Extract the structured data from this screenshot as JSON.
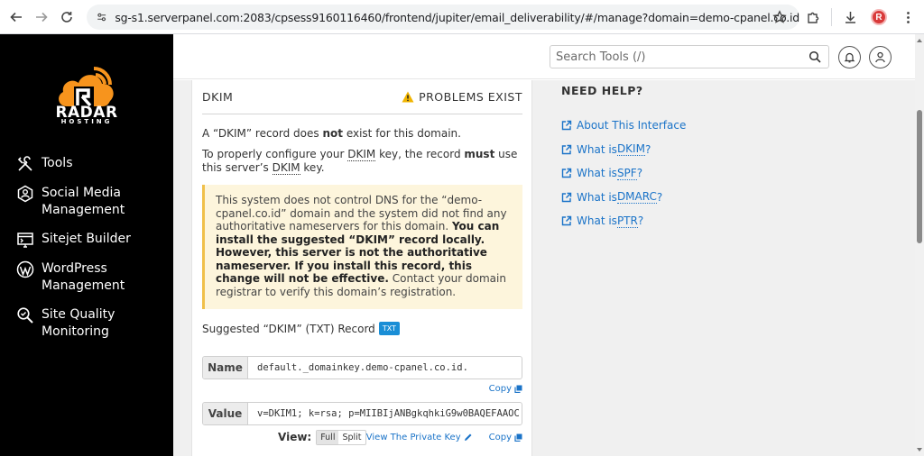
{
  "browser": {
    "url": "sg-s1.serverpanel.com:2083/cpsess9160116460/frontend/jupiter/email_deliverability/#/manage?domain=demo-cpanel.co.id",
    "profile_initial": "R"
  },
  "sidebar": {
    "logo_text": "RADAR",
    "logo_subtext": "HOSTING",
    "items": [
      {
        "label": "Tools",
        "icon": "tools-icon"
      },
      {
        "label": "Social Media Management",
        "icon": "social-media-icon"
      },
      {
        "label": "Sitejet Builder",
        "icon": "sitejet-icon"
      },
      {
        "label": "WordPress Management",
        "icon": "wordpress-icon"
      },
      {
        "label": "Site Quality Monitoring",
        "icon": "site-quality-icon"
      }
    ]
  },
  "header": {
    "search_placeholder": "Search Tools (/)"
  },
  "dkim": {
    "title": "DKIM",
    "status": "PROBLEMS EXIST",
    "line1_a": "A “DKIM” record does ",
    "line1_b": "not",
    "line1_c": " exist for this domain.",
    "line2_a": "To properly configure your ",
    "line2_abbr1": "DKIM",
    "line2_b": " key, the record ",
    "line2_must": "must",
    "line2_c": " use this server’s ",
    "line2_abbr2": "DKIM",
    "line2_d": " key.",
    "notice_a": "This system does not control DNS for the “demo-cpanel.co.id” domain and the system did not find any authoritative nameservers for this domain. ",
    "notice_b": "You can install the suggested “DKIM” record locally. However, this server is not the authoritative nameserver. If you install this record, this change will not be effective.",
    "notice_c": " Contact your domain registrar to verify this domain’s registration.",
    "suggested_label": "Suggested “DKIM” (TXT) Record",
    "badge": "TXT",
    "name_label": "Name",
    "name_value": "default._domainkey.demo-cpanel.co.id.",
    "value_label": "Value",
    "value_value": "v=DKIM1; k=rsa; p=MIIBIjANBgkqhkiG9w0BAQEFAAOC",
    "copy": "Copy",
    "view_label": "View:",
    "view_full": "Full",
    "view_split": "Split",
    "private_key": "View The Private Key"
  },
  "help": {
    "title": "NEED HELP?",
    "links": [
      {
        "pre": "About This Interface",
        "abbr": "",
        "post": ""
      },
      {
        "pre": "What is ",
        "abbr": "DKIM",
        "post": "?"
      },
      {
        "pre": "What is ",
        "abbr": "SPF",
        "post": "?"
      },
      {
        "pre": "What is ",
        "abbr": "DMARC",
        "post": "?"
      },
      {
        "pre": "What is ",
        "abbr": "PTR",
        "post": "?"
      }
    ]
  },
  "colors": {
    "sidebar_bg": "#000000",
    "logo_orange": "#f7941d",
    "link_blue": "#1a73c8",
    "badge_blue": "#1a8ed6",
    "notice_bg": "#fdf5dc",
    "warning_yellow": "#f0b400"
  }
}
